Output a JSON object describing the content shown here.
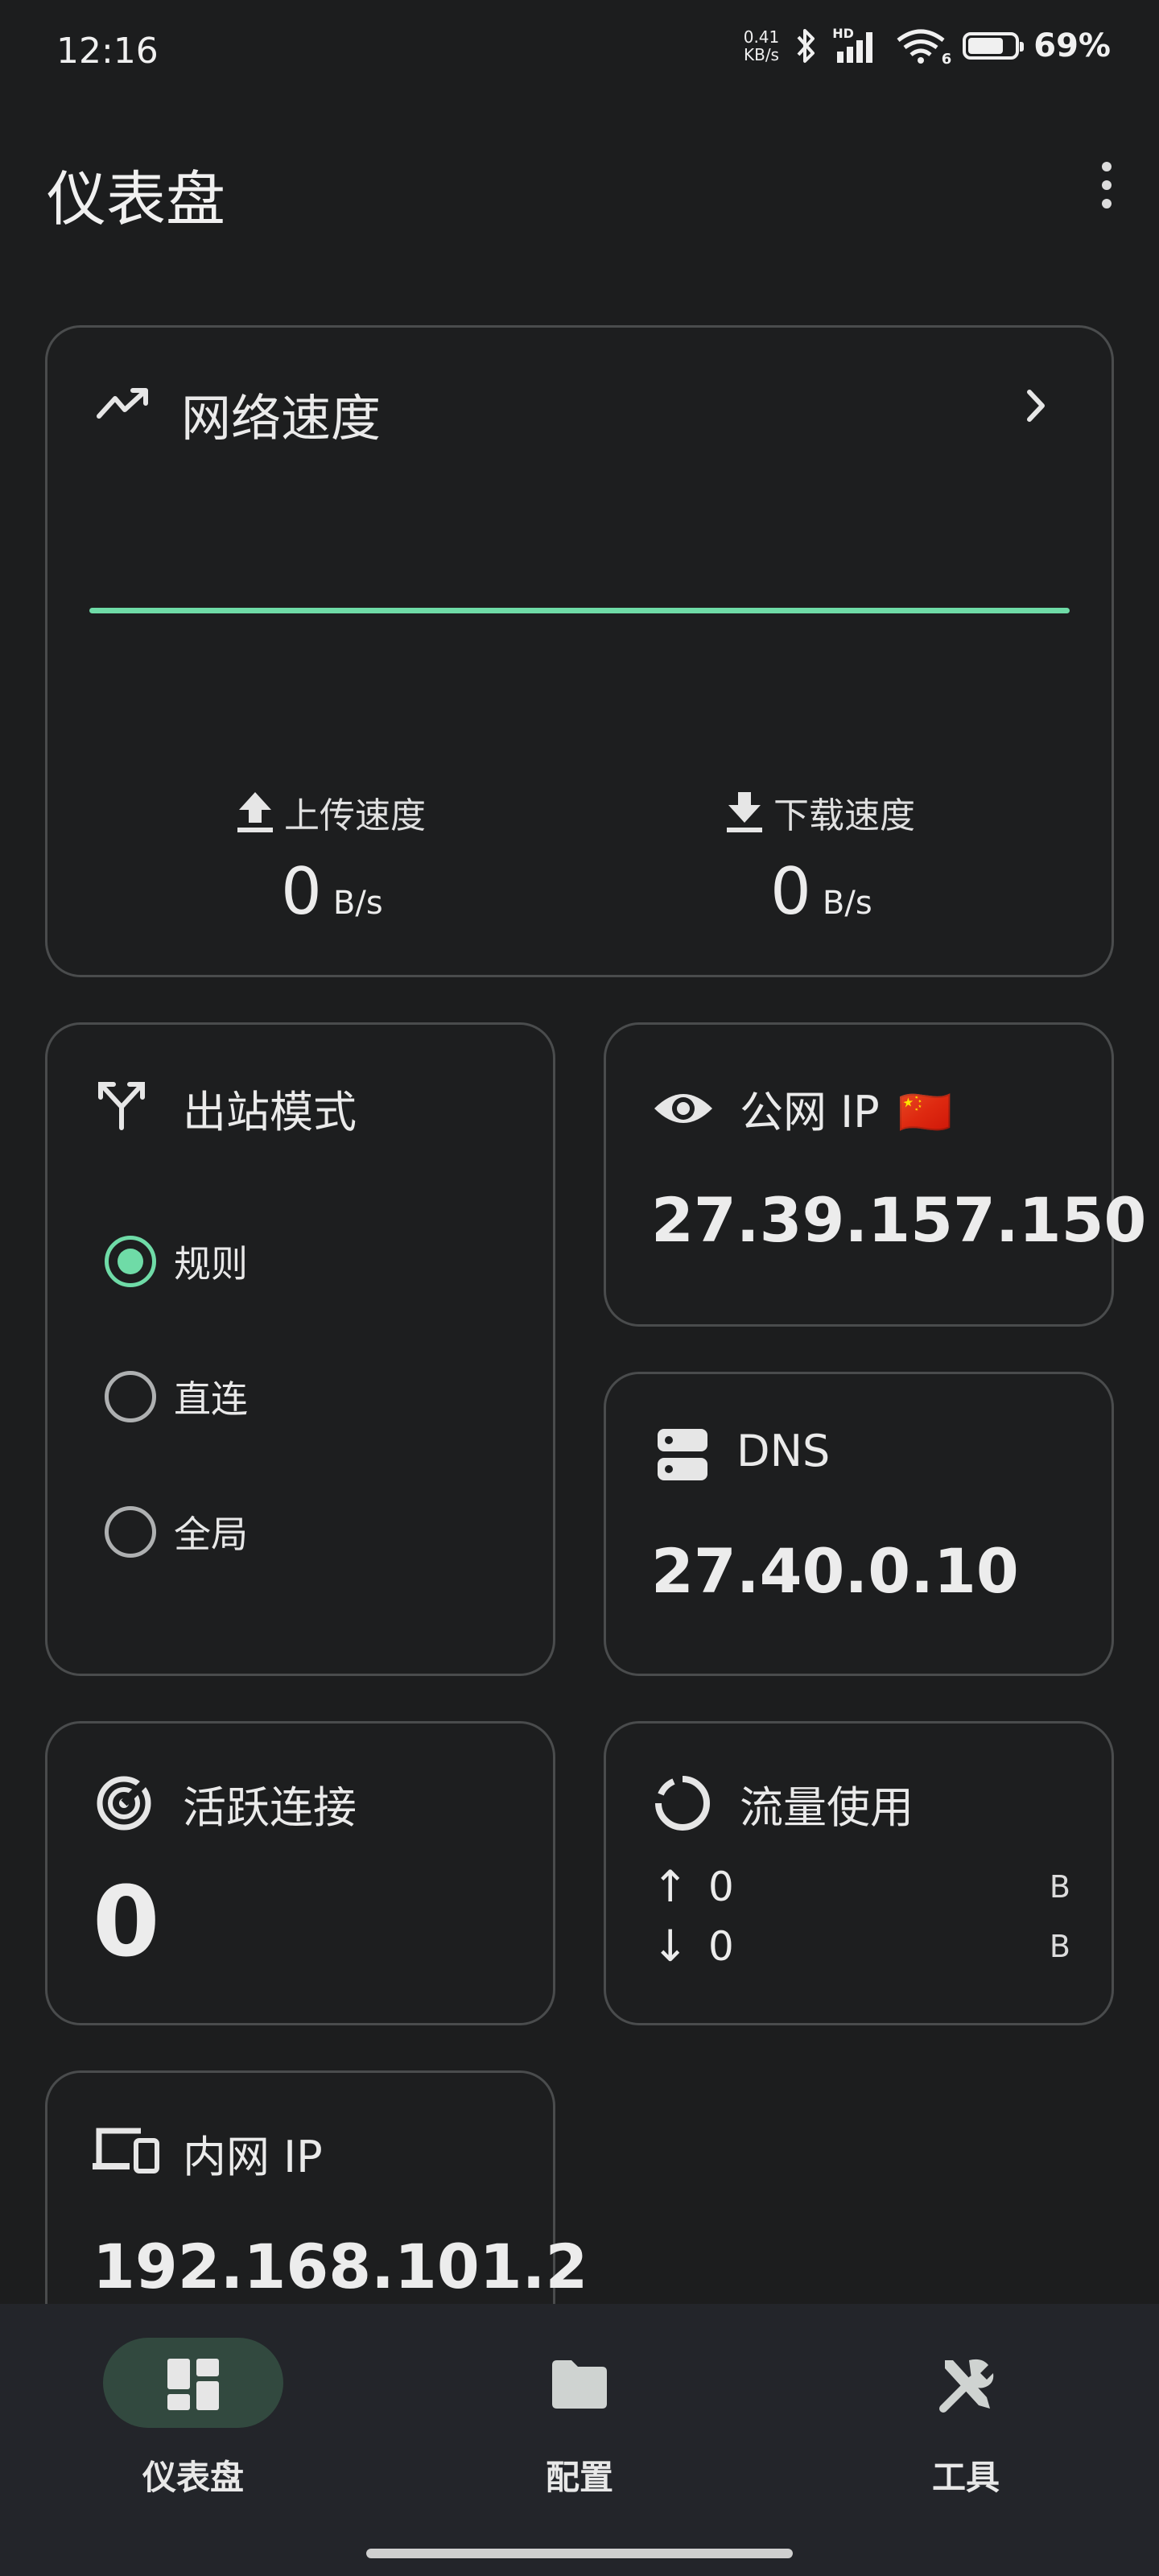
{
  "status_bar": {
    "time": "12:16",
    "net_speed_value": "0.41",
    "net_speed_unit": "KB/s",
    "signal_label": "HD",
    "wifi_label": "6",
    "battery_percent": "69%",
    "battery_level": 0.69
  },
  "app_bar": {
    "title": "仪表盘"
  },
  "network_speed": {
    "title": "网络速度",
    "upload_label": "上传速度",
    "upload_value": "0",
    "upload_unit": "B/s",
    "download_label": "下载速度",
    "download_value": "0",
    "download_unit": "B/s",
    "line_color": "#6fdba7"
  },
  "outbound_mode": {
    "title": "出站模式",
    "options": [
      {
        "label": "规则",
        "selected": true
      },
      {
        "label": "直连",
        "selected": false
      },
      {
        "label": "全局",
        "selected": false
      }
    ]
  },
  "public_ip": {
    "title": "公网 IP",
    "flag": "🇨🇳",
    "value": "27.39.157.150"
  },
  "dns": {
    "title": "DNS",
    "value": "27.40.0.10"
  },
  "active_connections": {
    "title": "活跃连接",
    "value": "0"
  },
  "traffic_usage": {
    "title": "流量使用",
    "upload_arrow": "↑",
    "upload_value": "0",
    "upload_unit": "B",
    "download_arrow": "↓",
    "download_value": "0",
    "download_unit": "B"
  },
  "local_ip": {
    "title": "内网 IP",
    "value": "192.168.101.2"
  },
  "bottom_nav": {
    "items": [
      {
        "label": "仪表盘",
        "icon": "dashboard-icon",
        "active": true
      },
      {
        "label": "配置",
        "icon": "folder-icon",
        "active": false
      },
      {
        "label": "工具",
        "icon": "tools-icon",
        "active": false
      }
    ]
  },
  "colors": {
    "accent": "#6fdba7",
    "background": "#1c1d1e",
    "card_border": "#4a4c4d",
    "nav_background": "#23252a"
  }
}
